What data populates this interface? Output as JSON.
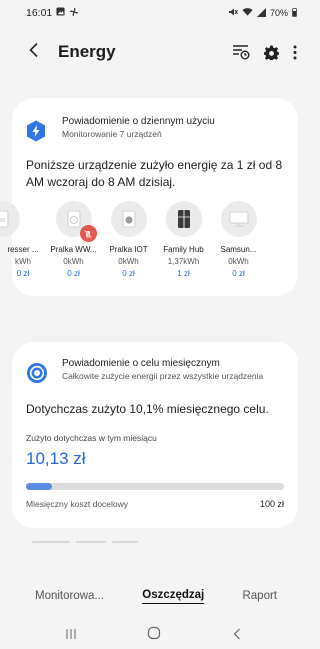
{
  "status_bar": {
    "time": "16:01",
    "battery": "70%"
  },
  "header": {
    "title": "Energy"
  },
  "daily_card": {
    "title": "Powiadomienie o dziennym użyciu",
    "subtitle": "Monitorowanie 7 urządzeń",
    "summary": "Poniższe urządzenie zużyło energię za 1 zł od 8 AM wczoraj do 8 AM dzisiaj.",
    "devices": [
      {
        "name": "resser ...",
        "kwh": "kWh",
        "cost": "0 zł"
      },
      {
        "name": "Pralka WW...",
        "kwh": "0kWh",
        "cost": "0 zł"
      },
      {
        "name": "Pralka IOT",
        "kwh": "0kWh",
        "cost": "0 zł"
      },
      {
        "name": "Family Hub",
        "kwh": "1,37kWh",
        "cost": "1 zł"
      },
      {
        "name": "Samsun...",
        "kwh": "0kWh",
        "cost": "0 zł"
      }
    ]
  },
  "monthly_card": {
    "title": "Powiadomienie o celu miesięcznym",
    "subtitle": "Całkowite zużycie energii przez wszystkie urządzenia",
    "summary": "Dotychczas zużyto 10,1% miesięcznego celu.",
    "month_label": "Zużyto dotychczas w tym miesiącu",
    "month_value": "10,13 zł",
    "progress_percent": 10.1,
    "goal_label": "Miesięczny koszt docelowy",
    "goal_value": "100 zł"
  },
  "tabs": [
    {
      "label": "Monitorowa..."
    },
    {
      "label": "Oszczędzaj"
    },
    {
      "label": "Raport"
    }
  ],
  "colors": {
    "accent": "#1f6ad8",
    "alert": "#e6584f",
    "card": "#ffffff",
    "background": "#f4f4f4"
  }
}
